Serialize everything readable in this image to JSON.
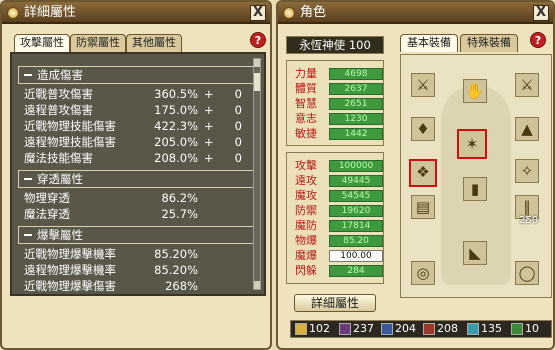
{
  "left": {
    "title": "詳細屬性",
    "close": "X",
    "help": "?",
    "tabs": [
      "攻擊屬性",
      "防禦屬性",
      "其他屬性"
    ],
    "sections": [
      {
        "name": "造成傷害",
        "rows": [
          {
            "label": "近戰普攻傷害",
            "value": "360.5%",
            "plus": "+",
            "extra": "0"
          },
          {
            "label": "遠程普攻傷害",
            "value": "175.0%",
            "plus": "+",
            "extra": "0"
          },
          {
            "label": "近戰物理技能傷害",
            "value": "422.3%",
            "plus": "+",
            "extra": "0"
          },
          {
            "label": "遠程物理技能傷害",
            "value": "205.0%",
            "plus": "+",
            "extra": "0"
          },
          {
            "label": "魔法技能傷害",
            "value": "208.0%",
            "plus": "+",
            "extra": "0"
          }
        ]
      },
      {
        "name": "穿透屬性",
        "rows": [
          {
            "label": "物理穿透",
            "value": "86.2%"
          },
          {
            "label": "魔法穿透",
            "value": "25.7%"
          }
        ]
      },
      {
        "name": "爆擊屬性",
        "rows": [
          {
            "label": "近戰物理爆擊機率",
            "value": "85.20%"
          },
          {
            "label": "遠程物理爆擊機率",
            "value": "85.20%"
          },
          {
            "label": "近戰物理爆擊傷害",
            "value": "268%"
          }
        ]
      }
    ]
  },
  "right": {
    "title": "角色",
    "close": "X",
    "help": "?",
    "character_name": "永恆神使",
    "level": "100",
    "tabs": [
      "基本裝備",
      "特殊裝備"
    ],
    "base_stats": [
      {
        "label": "力量",
        "value": "4698"
      },
      {
        "label": "體質",
        "value": "2637"
      },
      {
        "label": "智慧",
        "value": "2651"
      },
      {
        "label": "意志",
        "value": "1230"
      },
      {
        "label": "敏捷",
        "value": "1442"
      }
    ],
    "combat_stats": [
      {
        "label": "攻擊",
        "value": "100000"
      },
      {
        "label": "遠攻",
        "value": "49445"
      },
      {
        "label": "魔攻",
        "value": "54545"
      },
      {
        "label": "防禦",
        "value": "19620"
      },
      {
        "label": "魔防",
        "value": "17814"
      },
      {
        "label": "物爆",
        "value": "85.20"
      },
      {
        "label": "魔爆",
        "value": "100.00",
        "highlight": "white"
      },
      {
        "label": "閃躲",
        "value": "284"
      }
    ],
    "detail_button": "詳細屬性",
    "bag_count": "250",
    "equipment_icons": [
      "scythe-icon",
      "gauntlet-icon",
      "crossed-swords-icon",
      "necklace-icon",
      "crest-icon",
      "cape-icon",
      "amulet-icon",
      "greaves-icon",
      "crystal-shard-icon",
      "tome-icon",
      "legs-icon",
      "twin-blades-icon",
      "boots-icon",
      "ring-icon",
      "bracelet-icon"
    ],
    "resources": [
      {
        "value": "102",
        "color": "#d8b040"
      },
      {
        "value": "237",
        "color": "#6a3a7a"
      },
      {
        "value": "204",
        "color": "#3a5a9a"
      },
      {
        "value": "208",
        "color": "#9a3a2a"
      },
      {
        "value": "135",
        "color": "#3a9ab0"
      },
      {
        "value": "10",
        "color": "#3a8a3a"
      }
    ]
  }
}
